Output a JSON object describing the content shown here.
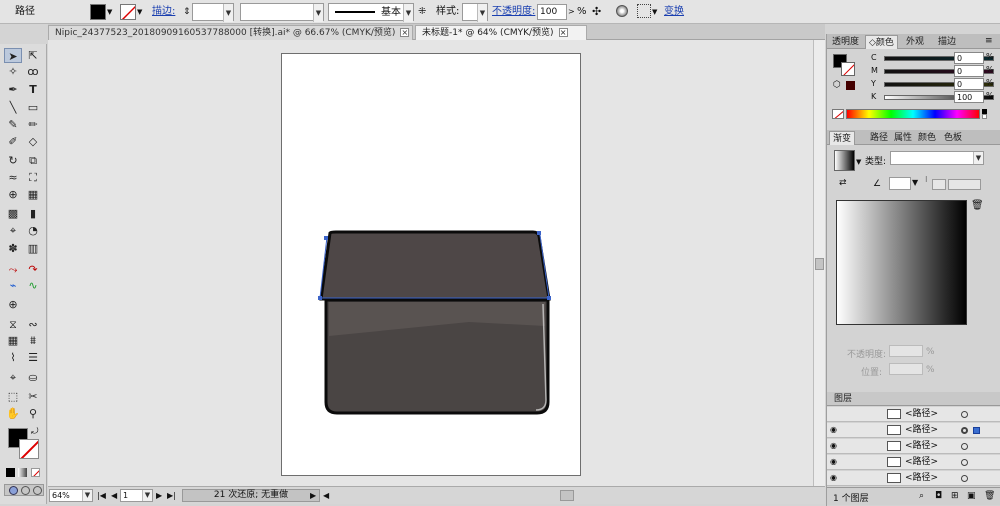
{
  "control_bar": {
    "object_type": "路径",
    "stroke_label": "描边:",
    "brush_label": "基本",
    "style_label": "样式:",
    "opacity_label": "不透明度:",
    "opacity_value": "100",
    "opacity_unit": "%",
    "transform_label": "变换",
    "fill_color": "#000000"
  },
  "doc_tabs": [
    {
      "label": "Nipic_24377523_20180909160537788000  [转换].ai* @ 66.67% (CMYK/预览)"
    },
    {
      "label": "未标题-1* @ 64% (CMYK/预览)"
    }
  ],
  "status_bar": {
    "zoom": "64%",
    "artboard_num": "1",
    "undo_info": "21 次还原; 无重做"
  },
  "color_panel": {
    "tabs": [
      "透明度",
      "颜色",
      "外观",
      "描边"
    ],
    "channels": [
      {
        "label": "C",
        "value": "0"
      },
      {
        "label": "M",
        "value": "0"
      },
      {
        "label": "Y",
        "value": "0"
      },
      {
        "label": "K",
        "value": "100"
      }
    ]
  },
  "gradient_panel": {
    "tabs": [
      "渐变",
      "路径",
      "属性",
      "颜色",
      "色板"
    ],
    "type_label": "类型:",
    "opacity_label": "不透明度:",
    "position_label": "位置:",
    "percent": "%"
  },
  "layers_panel": {
    "tab": "图层",
    "items": [
      {
        "name": "<路径>",
        "target": false
      },
      {
        "name": "<路径>",
        "target": true
      },
      {
        "name": "<路径>",
        "target": false
      },
      {
        "name": "<路径>",
        "target": false
      },
      {
        "name": "<路径>",
        "target": false
      }
    ],
    "footer": "1 个图层"
  },
  "icons": [
    "selection-arrow",
    "direct-selection",
    "magic-wand",
    "lasso",
    "pen",
    "type",
    "line",
    "rectangle",
    "paintbrush",
    "pencil",
    "blob-brush",
    "eraser",
    "rotate",
    "scale",
    "warp",
    "free-transform",
    "shape-builder",
    "perspective",
    "mesh",
    "gradient",
    "eyedropper",
    "blend",
    "symbol-sprayer",
    "column-graph",
    "artboard",
    "slice",
    "hand",
    "zoom",
    "fill-swatch",
    "stroke-swatch"
  ]
}
